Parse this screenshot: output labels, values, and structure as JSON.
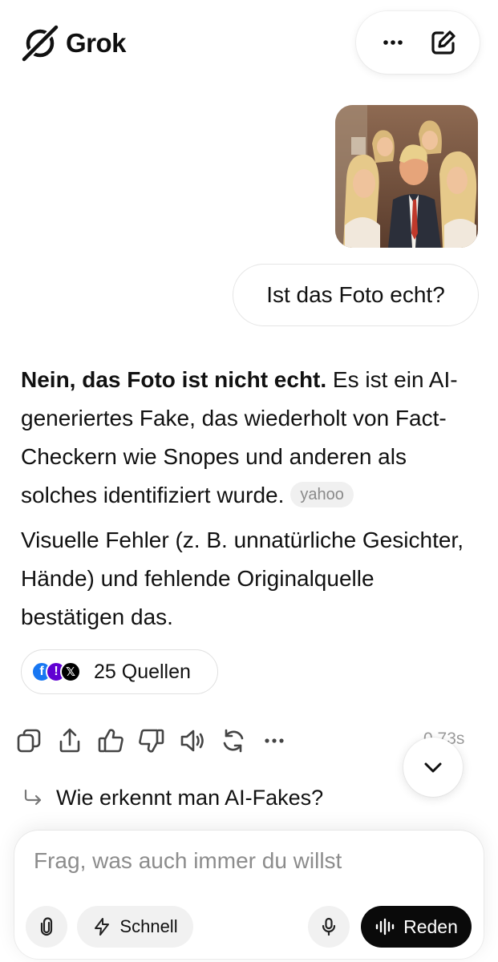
{
  "app": {
    "name": "Grok"
  },
  "header": {
    "more_icon": "more-horizontal-icon",
    "new_chat_icon": "edit-icon"
  },
  "user_message": {
    "image_icon": "photo",
    "text": "Ist das Foto echt?"
  },
  "answer": {
    "p1_bold": "Nein, das Foto ist nicht echt.",
    "p1_rest": " Es ist ein AI-generiertes Fake, das wiederholt von Fact-Checkern wie Snopes und anderen als solches identifiziert wurde.",
    "p1_source": "yahoo",
    "p2": "Visuelle Fehler (z. B. unnatürliche Gesichter, Hände) und fehlende Originalquelle bestätigen das."
  },
  "sources": {
    "label": "25 Quellen",
    "icons": [
      "f",
      "!",
      "𝕏"
    ]
  },
  "actions": [
    "copy-icon",
    "share-icon",
    "thumbs-up-icon",
    "thumbs-down-icon",
    "speaker-icon",
    "regenerate-icon",
    "more-icon"
  ],
  "timing": "0.73s",
  "followup": {
    "text": "Wie erkennt man AI-Fakes?"
  },
  "composer": {
    "placeholder": "Frag, was auch immer du willst",
    "mode_label": "Schnell",
    "voice_label": "Reden"
  },
  "colors": {
    "accent": "#0a0a0a",
    "chip_bg": "#f0f0f0",
    "muted": "#8c8c8c"
  }
}
